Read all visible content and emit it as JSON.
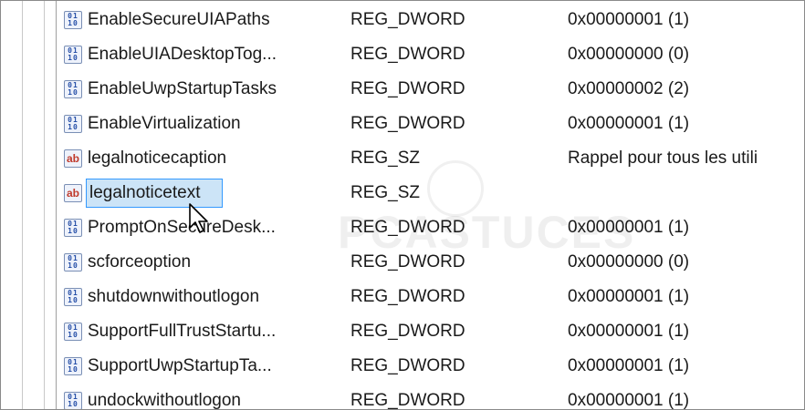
{
  "rows": [
    {
      "name": "EnableSecureUIAPaths",
      "type": "REG_DWORD",
      "data": "0x00000001 (1)",
      "icon": "binary"
    },
    {
      "name": "EnableUIADesktopTog...",
      "type": "REG_DWORD",
      "data": "0x00000000 (0)",
      "icon": "binary"
    },
    {
      "name": "EnableUwpStartupTasks",
      "type": "REG_DWORD",
      "data": "0x00000002 (2)",
      "icon": "binary"
    },
    {
      "name": "EnableVirtualization",
      "type": "REG_DWORD",
      "data": "0x00000001 (1)",
      "icon": "binary"
    },
    {
      "name": "legalnoticecaption",
      "type": "REG_SZ",
      "data": "Rappel pour tous les utili",
      "icon": "string"
    },
    {
      "name": "legalnoticetext",
      "type": "REG_SZ",
      "data": "",
      "icon": "string",
      "selected": true
    },
    {
      "name": "PromptOnSecureDesk...",
      "type": "REG_DWORD",
      "data": "0x00000001 (1)",
      "icon": "binary"
    },
    {
      "name": "scforceoption",
      "type": "REG_DWORD",
      "data": "0x00000000 (0)",
      "icon": "binary"
    },
    {
      "name": "shutdownwithoutlogon",
      "type": "REG_DWORD",
      "data": "0x00000001 (1)",
      "icon": "binary"
    },
    {
      "name": "SupportFullTrustStartu...",
      "type": "REG_DWORD",
      "data": "0x00000001 (1)",
      "icon": "binary"
    },
    {
      "name": "SupportUwpStartupTa...",
      "type": "REG_DWORD",
      "data": "0x00000001 (1)",
      "icon": "binary"
    },
    {
      "name": "undockwithoutlogon",
      "type": "REG_DWORD",
      "data": "0x00000001 (1)",
      "icon": "binary"
    }
  ],
  "icons": {
    "binary_line1": "01",
    "binary_line2": "10",
    "string": "ab"
  },
  "watermark": "PCASTUCES",
  "colors": {
    "selection_fill": "#cce4f7",
    "selection_border": "#3399ff",
    "binary_icon": "#2750a8",
    "string_icon": "#c0392b"
  }
}
